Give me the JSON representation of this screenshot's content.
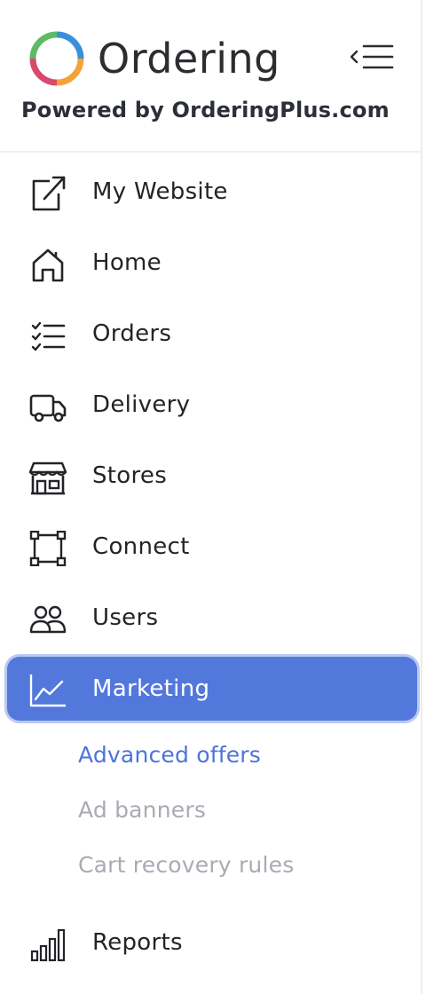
{
  "brand": {
    "name": "Ordering",
    "powered_by": "Powered by OrderingPlus.com",
    "logo_colors": [
      "#3b8fd9",
      "#5dbb63",
      "#f2a33a",
      "#d84a6b"
    ]
  },
  "nav": {
    "my_website": "My Website",
    "home": "Home",
    "orders": "Orders",
    "delivery": "Delivery",
    "stores": "Stores",
    "connect": "Connect",
    "users": "Users",
    "marketing": "Marketing",
    "reports": "Reports"
  },
  "marketing_sub": {
    "advanced_offers": "Advanced offers",
    "ad_banners": "Ad banners",
    "cart_recovery_rules": "Cart recovery rules"
  },
  "colors": {
    "active_bg": "#5378dc",
    "active_sub": "#4c74d8",
    "muted_sub": "#a8abb3"
  }
}
